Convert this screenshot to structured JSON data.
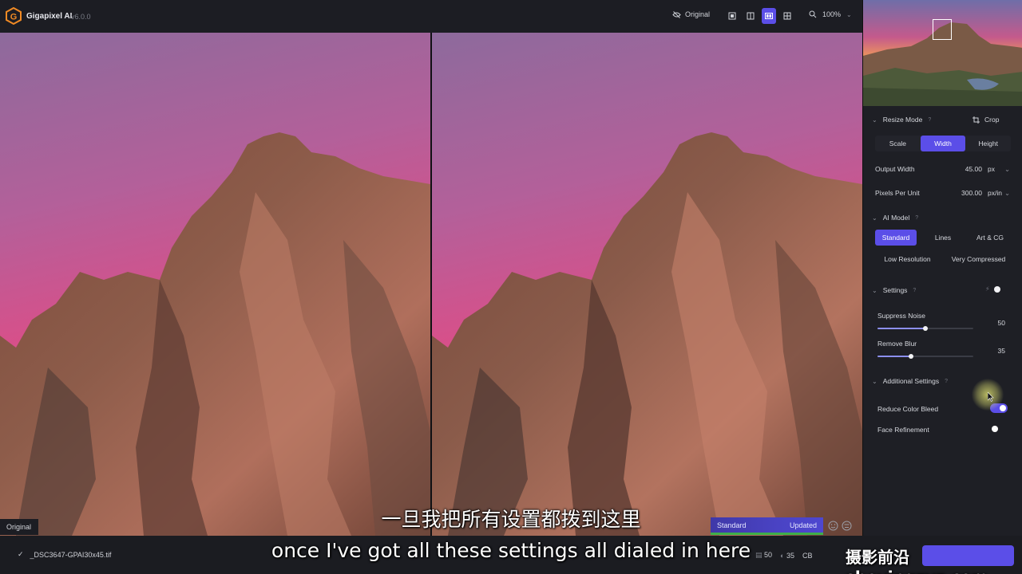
{
  "app": {
    "name": "Gigapixel AI",
    "version": "v6.0.0"
  },
  "toolbar": {
    "original_label": "Original",
    "zoom": "100%"
  },
  "viewer": {
    "pane_label": "Original"
  },
  "status": {
    "model": "Standard",
    "state": "Updated"
  },
  "file": {
    "name": "_DSC3647-GPAI30x45.tif",
    "stat1": "50",
    "stat2": "35",
    "stat3": "CB"
  },
  "panel": {
    "resize_mode": {
      "title": "Resize Mode",
      "help": "?",
      "crop": "Crop",
      "options": [
        "Scale",
        "Width",
        "Height"
      ],
      "selected": "Width"
    },
    "output_width": {
      "label": "Output Width",
      "value": "45.00",
      "unit": "px"
    },
    "pixels_per_unit": {
      "label": "Pixels Per Unit",
      "value": "300.00",
      "unit": "px/in"
    },
    "ai_model": {
      "title": "AI Model",
      "help": "?",
      "options": [
        "Standard",
        "Lines",
        "Art & CG",
        "Low Resolution",
        "Very Compressed"
      ],
      "selected": "Standard"
    },
    "settings": {
      "title": "Settings",
      "help": "?"
    },
    "suppress_noise": {
      "label": "Suppress Noise",
      "value": "50",
      "fraction": 0.5
    },
    "remove_blur": {
      "label": "Remove Blur",
      "value": "35",
      "fraction": 0.35
    },
    "additional": {
      "title": "Additional Settings",
      "help": "?"
    },
    "reduce_color_bleed": {
      "label": "Reduce Color Bleed",
      "on": true
    },
    "face_refinement": {
      "label": "Face Refinement",
      "on": false
    }
  },
  "subtitles": {
    "chinese": "一旦我把所有设置都拨到这里",
    "english": "once I've got all these settings all dialed in here"
  },
  "watermark": "摄影前沿 sheyingzyz.com",
  "colors": {
    "accent": "#5b4ee8",
    "sky_top": "#8a5f9a",
    "sky_bottom": "#d9508a",
    "rock": "#8a5a48"
  }
}
